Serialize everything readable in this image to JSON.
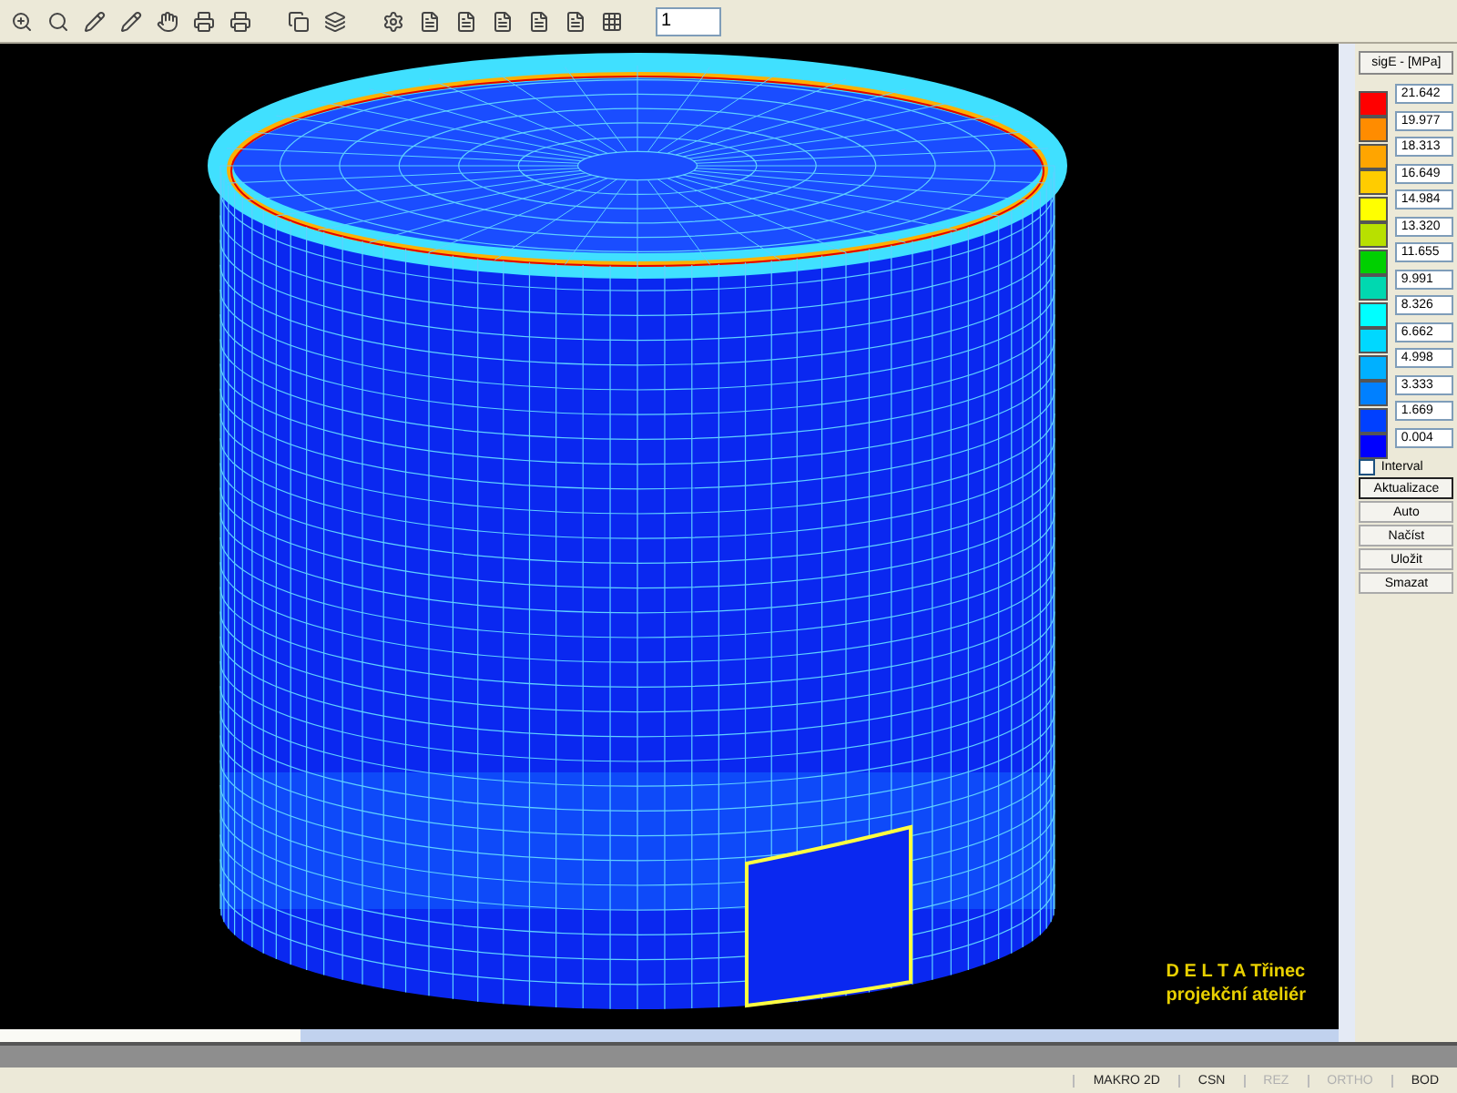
{
  "toolbar": {
    "page_field": {
      "value": "1"
    }
  },
  "viewport": {
    "logo_lines": [
      "D E L T A  Třinec",
      "projekční ateliér"
    ]
  },
  "legend": {
    "title": "sigE - [MPa]",
    "items": [
      {
        "color": "#ff0000",
        "value": "21.642"
      },
      {
        "color": "#ff8c00",
        "value": "19.977"
      },
      {
        "color": "#ffa500",
        "value": "18.313"
      },
      {
        "color": "#ffcc00",
        "value": "16.649"
      },
      {
        "color": "#ffff00",
        "value": "14.984"
      },
      {
        "color": "#b8e000",
        "value": "13.320"
      },
      {
        "color": "#00d000",
        "value": "11.655"
      },
      {
        "color": "#00d8b0",
        "value": "9.991"
      },
      {
        "color": "#00ffff",
        "value": "8.326"
      },
      {
        "color": "#00d8ff",
        "value": "6.662"
      },
      {
        "color": "#00b0ff",
        "value": "4.998"
      },
      {
        "color": "#0080ff",
        "value": "3.333"
      },
      {
        "color": "#0040ff",
        "value": "1.669"
      },
      {
        "color": "#0000ff",
        "value": "0.004"
      }
    ],
    "interval": {
      "label": "Interval",
      "checked": false
    },
    "buttons": [
      {
        "label": "Aktualizace",
        "selected": true
      },
      {
        "label": "Auto",
        "selected": false
      },
      {
        "label": "Načíst",
        "selected": false
      },
      {
        "label": "Uložit",
        "selected": false
      },
      {
        "label": "Smazat",
        "selected": false
      }
    ]
  },
  "status_bar": [
    {
      "label": "MAKRO 2D",
      "disabled": false
    },
    {
      "label": "CSN",
      "disabled": false
    },
    {
      "label": "REZ",
      "disabled": true
    },
    {
      "label": "ORTHO",
      "disabled": true
    },
    {
      "label": "BOD",
      "disabled": false
    }
  ]
}
